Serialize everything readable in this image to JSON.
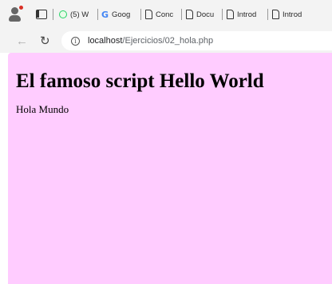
{
  "browser": {
    "tabs": [
      {
        "icon": "whatsapp-icon",
        "label": "(5) W"
      },
      {
        "icon": "google-icon",
        "label": "Goog"
      },
      {
        "icon": "document-icon",
        "label": "Conc"
      },
      {
        "icon": "document-icon",
        "label": "Docu"
      },
      {
        "icon": "document-icon",
        "label": "Introd"
      },
      {
        "icon": "document-icon",
        "label": "Introd"
      }
    ],
    "url_host": "localhost",
    "url_path": "/Ejercicios/02_hola.php"
  },
  "page": {
    "background": "#ffccff",
    "heading": "El famoso script Hello World",
    "text": "Hola Mundo"
  }
}
